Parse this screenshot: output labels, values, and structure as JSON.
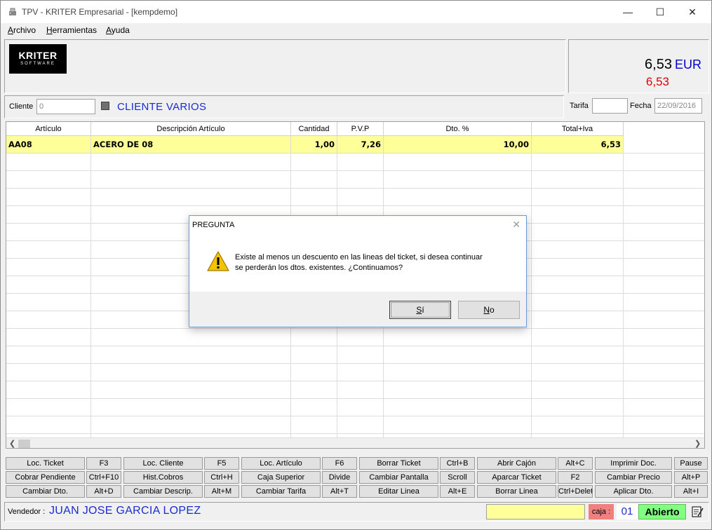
{
  "window": {
    "title": "TPV - KRITER Empresarial - [kempdemo]",
    "minimize": "—",
    "maximize": "☐",
    "close": "✕"
  },
  "menu": [
    {
      "first": "A",
      "rest": "rchivo"
    },
    {
      "first": "H",
      "rest": "erramientas"
    },
    {
      "first": "A",
      "rest": "yuda"
    }
  ],
  "logo": {
    "line1": "KRITER",
    "line2": "SOFTWARE"
  },
  "totals": {
    "amount": "6,53",
    "currency": "EUR",
    "secondary": "6,53"
  },
  "client": {
    "label": "Cliente",
    "code": "0",
    "name": "CLIENTE VARIOS",
    "tarifa_label": "Tarifa",
    "tarifa_value": "",
    "fecha_label": "Fecha",
    "fecha_value": "22/09/2016"
  },
  "grid": {
    "columns": [
      "Artículo",
      "Descripción Artículo",
      "Cantidad",
      "P.V.P",
      "Dto. %",
      "Total+Iva"
    ],
    "rows": [
      {
        "articulo": "AA08",
        "descripcion": "ACERO DE 08",
        "cantidad": "1,00",
        "pvp": "7,26",
        "dto": "10,00",
        "total": "6,53"
      }
    ]
  },
  "buttons": {
    "row1": [
      "Loc. Ticket",
      "F3",
      "Loc. Cliente",
      "F5",
      "Loc. Artículo",
      "F6",
      "Borrar Ticket",
      "Ctrl+B",
      "Abrir Cajón",
      "Alt+C",
      "Imprimir Doc.",
      "Pause"
    ],
    "row2": [
      "Cobrar Pendiente",
      "Ctrl+F10",
      "Hist.Cobros",
      "Ctrl+H",
      "Caja Superior",
      "Divide",
      "Cambiar Pantalla",
      "Scroll",
      "Aparcar Ticket",
      "F2",
      "Cambiar Precio",
      "Alt+P"
    ],
    "row3": [
      "Cambiar Dto.",
      "Alt+D",
      "Cambiar Descrip.",
      "Alt+M",
      "Cambiar Tarifa",
      "Alt+T",
      "Editar Linea",
      "Alt+E",
      "Borrar Linea",
      "Ctrl+Delete",
      "Aplicar Dto.",
      "Alt+I"
    ]
  },
  "status": {
    "vendedor_label": "Vendedor :",
    "vendedor_name": "JUAN JOSE GARCIA LOPEZ",
    "caja_label": "caja :",
    "caja_num": "01",
    "estado": "Abierto"
  },
  "dialog": {
    "title": "PREGUNTA",
    "line1": "Existe al menos un descuento en las lineas del ticket, si desea continuar",
    "line2": "se perderán los dtos. existentes. ¿Continuamos?",
    "yes_first": "S",
    "yes_rest": "í",
    "no_first": "N",
    "no_rest": "o"
  }
}
